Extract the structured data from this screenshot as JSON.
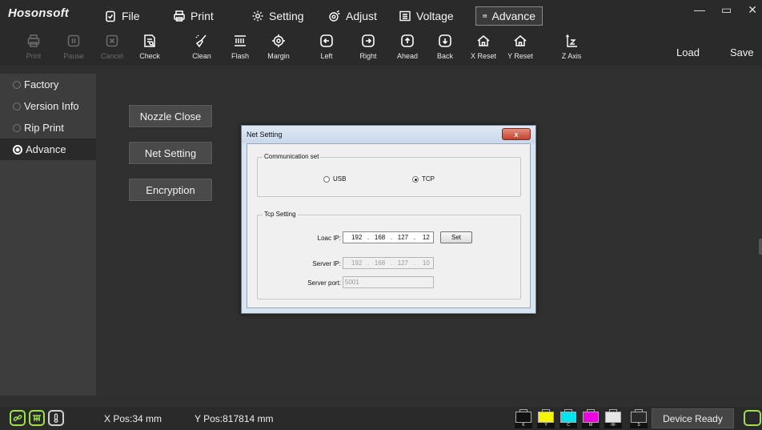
{
  "app": {
    "brand": "Hosonsoft"
  },
  "menu": [
    {
      "label": "File",
      "icon": "clipboard-check-icon"
    },
    {
      "label": "Print",
      "icon": "printer-icon"
    },
    {
      "label": "Setting",
      "icon": "gear-icon"
    },
    {
      "label": "Adjust",
      "icon": "adjust-gear-icon"
    },
    {
      "label": "Voltage",
      "icon": "list-icon"
    },
    {
      "label": "Advance",
      "icon": "advance-window-icon",
      "active": true
    }
  ],
  "window_controls": {
    "minimize": "—",
    "maximize": "▭",
    "close": "✕"
  },
  "toolbar": {
    "print": "Print",
    "pause": "Pause",
    "cancel": "Cancel",
    "check": "Check",
    "clean": "Clean",
    "flash": "Flash",
    "margin": "Margin",
    "left": "Left",
    "right": "Right",
    "ahead": "Ahead",
    "back": "Back",
    "x_reset": "X Reset",
    "y_reset": "Y Reset",
    "z_axis": "Z Axis",
    "load": "Load",
    "save": "Save"
  },
  "sidebar": {
    "items": [
      {
        "label": "Factory"
      },
      {
        "label": "Version Info"
      },
      {
        "label": "Rip Print"
      },
      {
        "label": "Advance",
        "active": true
      }
    ]
  },
  "main": {
    "buttons": {
      "nozzle_close": "Nozzle Close",
      "net_setting": "Net Setting",
      "encryption": "Encryption"
    }
  },
  "dialog": {
    "title": "Net Setting",
    "close": "x",
    "communication": {
      "legend": "Communication set",
      "usb": "USB",
      "tcp": "TCP",
      "selected": "TCP"
    },
    "tcp": {
      "legend": "Tcp Setting",
      "local_ip_label": "Loac IP:",
      "local_ip": [
        "192",
        "168",
        "127",
        "12"
      ],
      "set_button": "Set",
      "server_ip_label": "Server IP:",
      "server_ip": [
        "192",
        "168",
        "127",
        "10"
      ],
      "server_port_label": "Server port:",
      "server_port": "5001"
    }
  },
  "status": {
    "xpos": "X Pos:34 mm",
    "ypos": "Y Pos:817814 mm",
    "inks": [
      {
        "tag": "K",
        "color": "#111111"
      },
      {
        "tag": "Y",
        "color": "#f5f500"
      },
      {
        "tag": "C",
        "color": "#00e5f0"
      },
      {
        "tag": "M",
        "color": "#f000e0"
      },
      {
        "tag": "-W-",
        "color": "#e6e6e6"
      },
      {
        "tag": "S",
        "color": "#2a2a2a"
      }
    ],
    "device": "Device Ready"
  },
  "colors": {
    "accent_green": "#9ee04a",
    "bg_dark": "#2a2a2a",
    "dialog_frame": "#d7e4f2"
  }
}
